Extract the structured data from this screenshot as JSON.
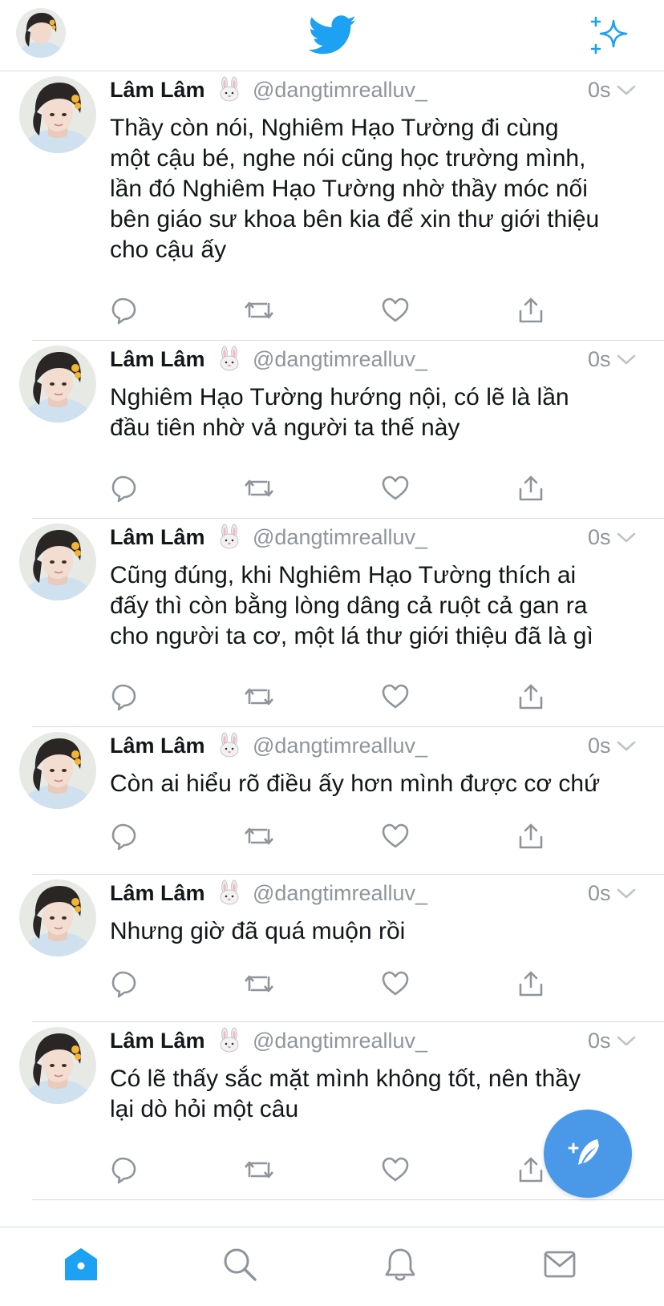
{
  "header": {
    "profile_avatar": "profile-photo",
    "logo_icon": "twitter-bird-icon",
    "timeline_icon": "sparkle-icon"
  },
  "tweets": [
    {
      "author_name": "Lâm Lâm",
      "author_emoji": "rabbit-face",
      "handle": "@dangtimrealluv_",
      "time": "0s",
      "lines": [
        "Thầy còn nói, Nghiêm Hạo Tường đi cùng",
        "một cậu bé, nghe nói cũng học trường mình,",
        "lần đó Nghiêm Hạo Tường nhờ thầy móc nối",
        "bên giáo sư khoa bên kia để xin thư giới thiệu",
        "cho cậu ấy"
      ]
    },
    {
      "author_name": "Lâm Lâm",
      "author_emoji": "rabbit-face",
      "handle": "@dangtimrealluv_",
      "time": "0s",
      "lines": [
        "Nghiêm Hạo Tường hướng nội, có lẽ là lần",
        "đầu tiên nhờ vả người ta thế này"
      ]
    },
    {
      "author_name": "Lâm Lâm",
      "author_emoji": "rabbit-face",
      "handle": "@dangtimrealluv_",
      "time": "0s",
      "lines": [
        "Cũng đúng, khi Nghiêm Hạo Tường thích ai",
        "đấy thì còn bằng lòng dâng cả ruột cả gan ra",
        "cho người ta cơ, một lá thư giới thiệu đã là gì"
      ]
    },
    {
      "author_name": "Lâm Lâm",
      "author_emoji": "rabbit-face",
      "handle": "@dangtimrealluv_",
      "time": "0s",
      "lines": [
        "Còn ai hiểu rõ điều ấy hơn mình được cơ chứ"
      ]
    },
    {
      "author_name": "Lâm Lâm",
      "author_emoji": "rabbit-face",
      "handle": "@dangtimrealluv_",
      "time": "0s",
      "lines": [
        "Nhưng giờ đã quá muộn rồi"
      ]
    },
    {
      "author_name": "Lâm Lâm",
      "author_emoji": "rabbit-face",
      "handle": "@dangtimrealluv_",
      "time": "0s",
      "lines": [
        "Có lẽ thấy sắc mặt mình không tốt, nên thầy",
        "lại dò hỏi một câu"
      ]
    }
  ],
  "actions": [
    "reply-icon",
    "retweet-icon",
    "like-icon",
    "share-icon"
  ],
  "compose_icon": "compose-tweet-icon",
  "tabbar": {
    "tabs": [
      "home-icon",
      "search-icon",
      "notifications-icon",
      "messages-icon"
    ],
    "active": "home-icon"
  },
  "colors": {
    "accent": "#1da1f2",
    "fab": "#4a99e9",
    "muted_text": "#8f959b",
    "icon_gray": "#8f959b",
    "divider": "#d6d9dc"
  }
}
